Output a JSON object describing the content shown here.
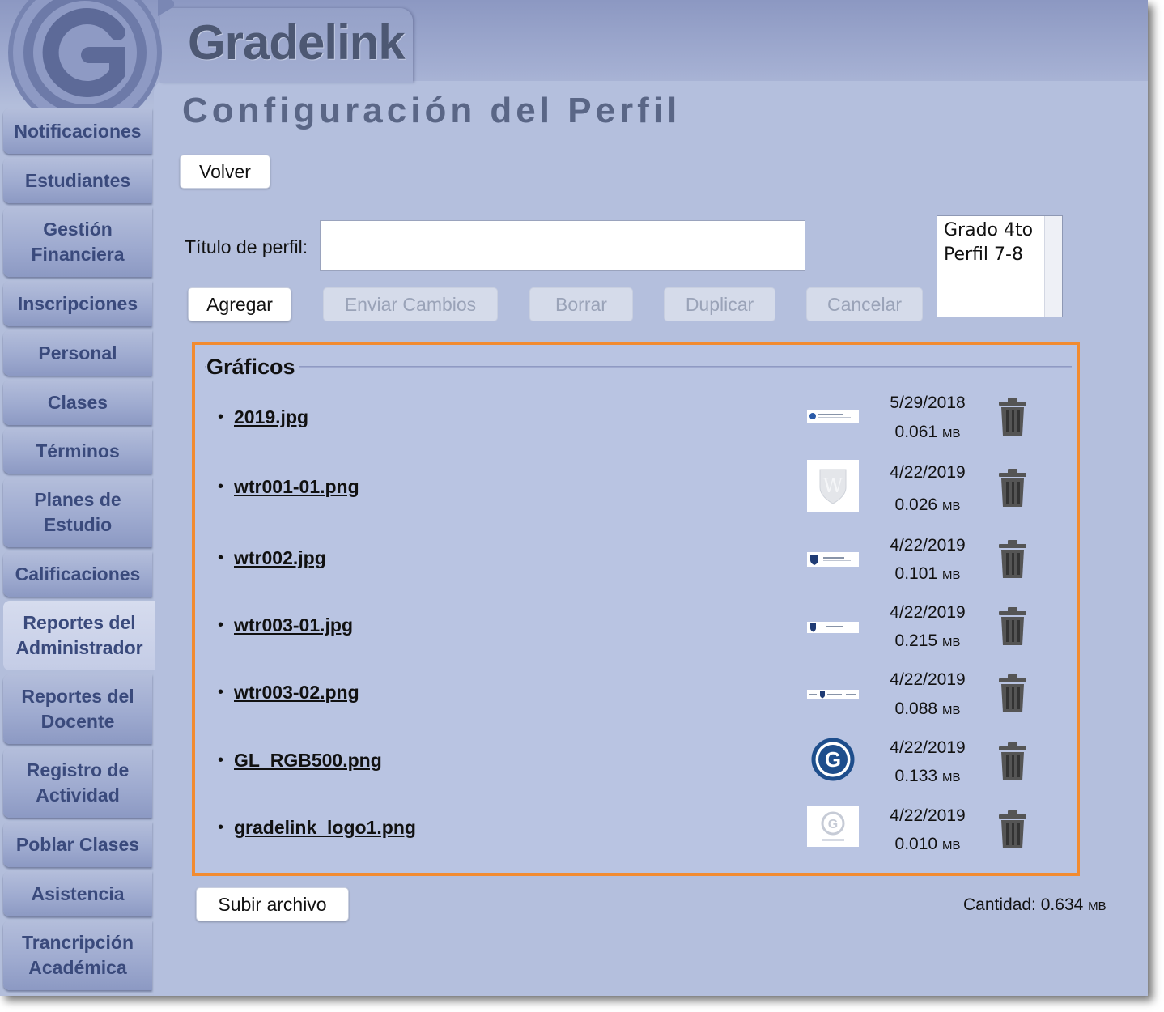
{
  "app": {
    "brand": "Gradelink"
  },
  "sidebar": {
    "items": [
      {
        "label": "Notificaciones"
      },
      {
        "label": "Estudiantes"
      },
      {
        "label": "Gestión Financiera"
      },
      {
        "label": "Inscripciones"
      },
      {
        "label": "Personal"
      },
      {
        "label": "Clases"
      },
      {
        "label": "Términos"
      },
      {
        "label": "Planes de Estudio"
      },
      {
        "label": "Calificaciones"
      },
      {
        "label": "Reportes del Administrador"
      },
      {
        "label": "Reportes del Docente"
      },
      {
        "label": "Registro de Actividad"
      },
      {
        "label": "Poblar Clases"
      },
      {
        "label": "Asistencia"
      },
      {
        "label": "Trancripción Académica"
      }
    ],
    "active_item": "Reportes del Administrador"
  },
  "main": {
    "title": "Configuración del Perfil",
    "back_button": "Volver",
    "profile_title_label": "Título de perfil:",
    "profile_title_value": "",
    "profiles": [
      "Grado 4to",
      "Perfil 7-8"
    ],
    "actions": {
      "add": "Agregar",
      "send_changes": "Enviar Cambios",
      "delete": "Borrar",
      "duplicate": "Duplicar",
      "cancel": "Cancelar"
    },
    "graphics": {
      "legend": "Gráficos",
      "files": [
        {
          "name": "2019.jpg",
          "date": "5/29/2018",
          "size": "0.061",
          "unit": "MB",
          "thumb": "banner-blue-icon"
        },
        {
          "name": "wtr001-01.png",
          "date": "4/22/2019",
          "size": "0.026",
          "unit": "MB",
          "thumb": "shield-w-icon"
        },
        {
          "name": "wtr002.jpg",
          "date": "4/22/2019",
          "size": "0.101",
          "unit": "MB",
          "thumb": "banner-shield-icon"
        },
        {
          "name": "wtr003-01.jpg",
          "date": "4/22/2019",
          "size": "0.215",
          "unit": "MB",
          "thumb": "banner-shield-icon"
        },
        {
          "name": "wtr003-02.png",
          "date": "4/22/2019",
          "size": "0.088",
          "unit": "MB",
          "thumb": "banner-shield-icon"
        },
        {
          "name": "GL_RGB500.png",
          "date": "4/22/2019",
          "size": "0.133",
          "unit": "MB",
          "thumb": "gradelink-g-icon"
        },
        {
          "name": "gradelink_logo1.png",
          "date": "4/22/2019",
          "size": "0.010",
          "unit": "MB",
          "thumb": "gradelink-logo-light-icon"
        }
      ]
    },
    "upload_button": "Subir archivo",
    "total_label": "Cantidad:",
    "total_value": "0.634",
    "total_unit": "MB"
  },
  "colors": {
    "accent_border": "#f28b30",
    "nav_text": "#3a4a7c",
    "background": "#b3bedb"
  }
}
